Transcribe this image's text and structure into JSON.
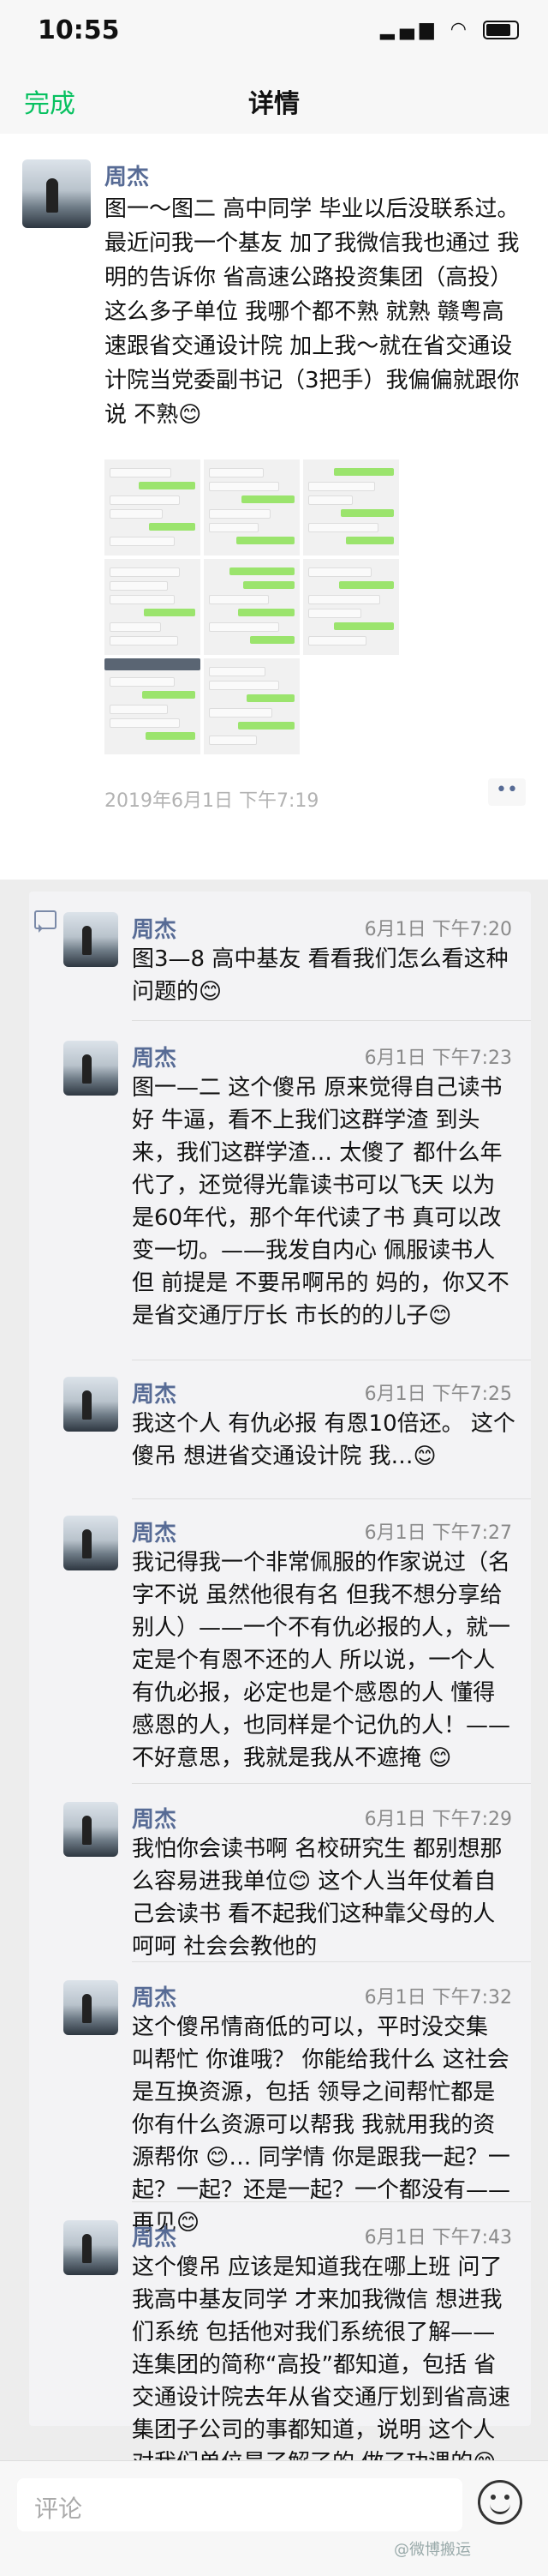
{
  "status_bar": {
    "time": "10:55"
  },
  "nav": {
    "done_label": "完成",
    "title": "详情"
  },
  "post": {
    "author": "周杰",
    "text": "图一～图二 高中同学 毕业以后没联系过。最近问我一个基友 加了我微信我也通过 我明的告诉你 省高速公路投资集团（高投）这么多子单位 我哪个都不熟 就熟 赣粤高速跟省交通设计院 加上我～就在省交通设计院当党委副书记（3把手）我偏偏就跟你说 不熟😊",
    "time": "2019年6月1日 下午7:19",
    "more_label": "••"
  },
  "comments": [
    {
      "author": "周杰",
      "time": "6月1日 下午7:20",
      "text": "图3—8 高中基友 看看我们怎么看这种问题的😊"
    },
    {
      "author": "周杰",
      "time": "6月1日 下午7:23",
      "text": "图一—二 这个傻吊 原来觉得自己读书好 牛逼，看不上我们这群学渣 到头来，我们这群学渣… 太傻了 都什么年代了，还觉得光靠读书可以飞天 以为是60年代，那个年代读了书 真可以改变一切。——我发自内心 佩服读书人 但 前提是 不要吊啊吊的 妈的，你又不是省交通厅厅长 市长的的儿子😊"
    },
    {
      "author": "周杰",
      "time": "6月1日 下午7:25",
      "text": "我这个人 有仇必报 有恩10倍还。 这个傻吊 想进省交通设计院 我…😊"
    },
    {
      "author": "周杰",
      "time": "6月1日 下午7:27",
      "text": "我记得我一个非常佩服的作家说过（名字不说 虽然他很有名 但我不想分享给别人）——一个不有仇必报的人，就一定是个有恩不还的人 所以说，一个人有仇必报，必定也是个感恩的人 懂得感恩的人，也同样是个记仇的人！——不好意思，我就是我从不遮掩 😊"
    },
    {
      "author": "周杰",
      "time": "6月1日 下午7:29",
      "text": "我怕你会读书啊 名校研究生 都别想那么容易进我单位😊 这个人当年仗着自己会读书 看不起我们这种靠父母的人 呵呵 社会会教他的"
    },
    {
      "author": "周杰",
      "time": "6月1日 下午7:32",
      "text": "这个傻吊情商低的可以，平时没交集 叫帮忙 你谁哦？ 你能给我什么 这社会是互换资源，包括 领导之间帮忙都是 你有什么资源可以帮我 我就用我的资源帮你 😊… 同学情 你是跟我一起？一起？一起？还是一起？一个都没有——再见😊"
    },
    {
      "author": "周杰",
      "time": "6月1日 下午7:43",
      "text": "这个傻吊 应该是知道我在哪上班 问了我高中基友同学 才来加我微信 想进我们系统 包括他对我们系统很了解——连集团的简称“高投”都知道，包括 省交通设计院去年从省交通厅划到省高速集团子公司的事都知道，说明 这个人对我们单位是了解了的 做了功课的😊"
    }
  ],
  "footer": {
    "comment_placeholder": "评论"
  },
  "watermark": "@微博搬运"
}
